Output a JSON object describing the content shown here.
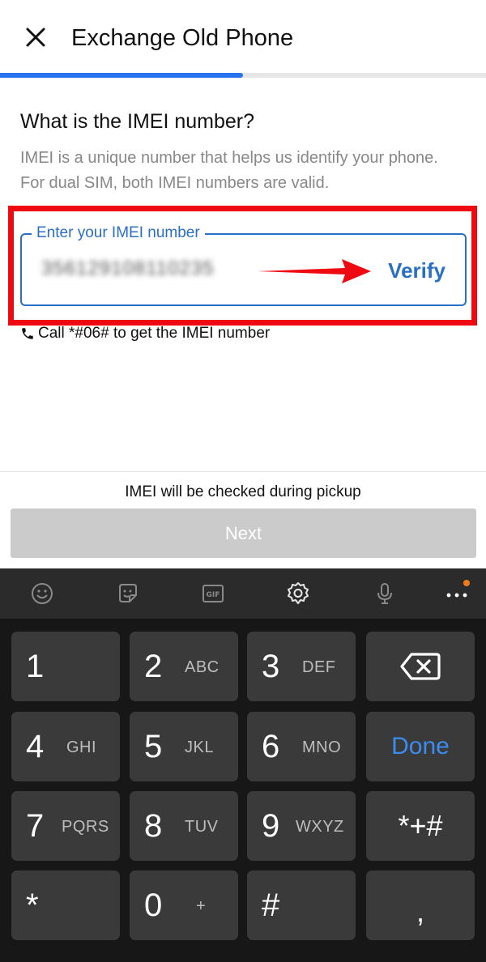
{
  "header": {
    "title": "Exchange Old Phone",
    "progress_fraction": 0.5
  },
  "question": {
    "heading": "What is the IMEI number?",
    "description": "IMEI is a unique number that helps us identify your phone. For dual SIM, both IMEI numbers are valid."
  },
  "imei_field": {
    "label": "Enter your IMEI number",
    "value": "356129108110235",
    "verify_label": "Verify"
  },
  "call_hint": "Call *#06# to get the IMEI number",
  "footer": {
    "pickup_note": "IMEI will be checked during pickup",
    "next_label": "Next"
  },
  "keyboard": {
    "toolbar_icons": [
      "smiley-icon",
      "sticker-icon",
      "gif-icon",
      "settings-icon",
      "microphone-icon",
      "more-icon"
    ],
    "keys": {
      "k1": {
        "num": "1",
        "letters": ""
      },
      "k2": {
        "num": "2",
        "letters": "ABC"
      },
      "k3": {
        "num": "3",
        "letters": "DEF"
      },
      "k4": {
        "num": "4",
        "letters": "GHI"
      },
      "k5": {
        "num": "5",
        "letters": "JKL"
      },
      "k6": {
        "num": "6",
        "letters": "MNO"
      },
      "k7": {
        "num": "7",
        "letters": "PQRS"
      },
      "k8": {
        "num": "8",
        "letters": "TUV"
      },
      "k9": {
        "num": "9",
        "letters": "WXYZ"
      },
      "k0": {
        "num": "0",
        "letters": "+"
      },
      "star": "*",
      "hash": "#",
      "star_plus_hash": "*+#",
      "comma": ",",
      "done": "Done"
    }
  },
  "colors": {
    "accent_blue": "#2874f0",
    "highlight_red": "#ee0a10",
    "field_blue": "#2a6fc6",
    "done_blue": "#3b8cf0"
  }
}
